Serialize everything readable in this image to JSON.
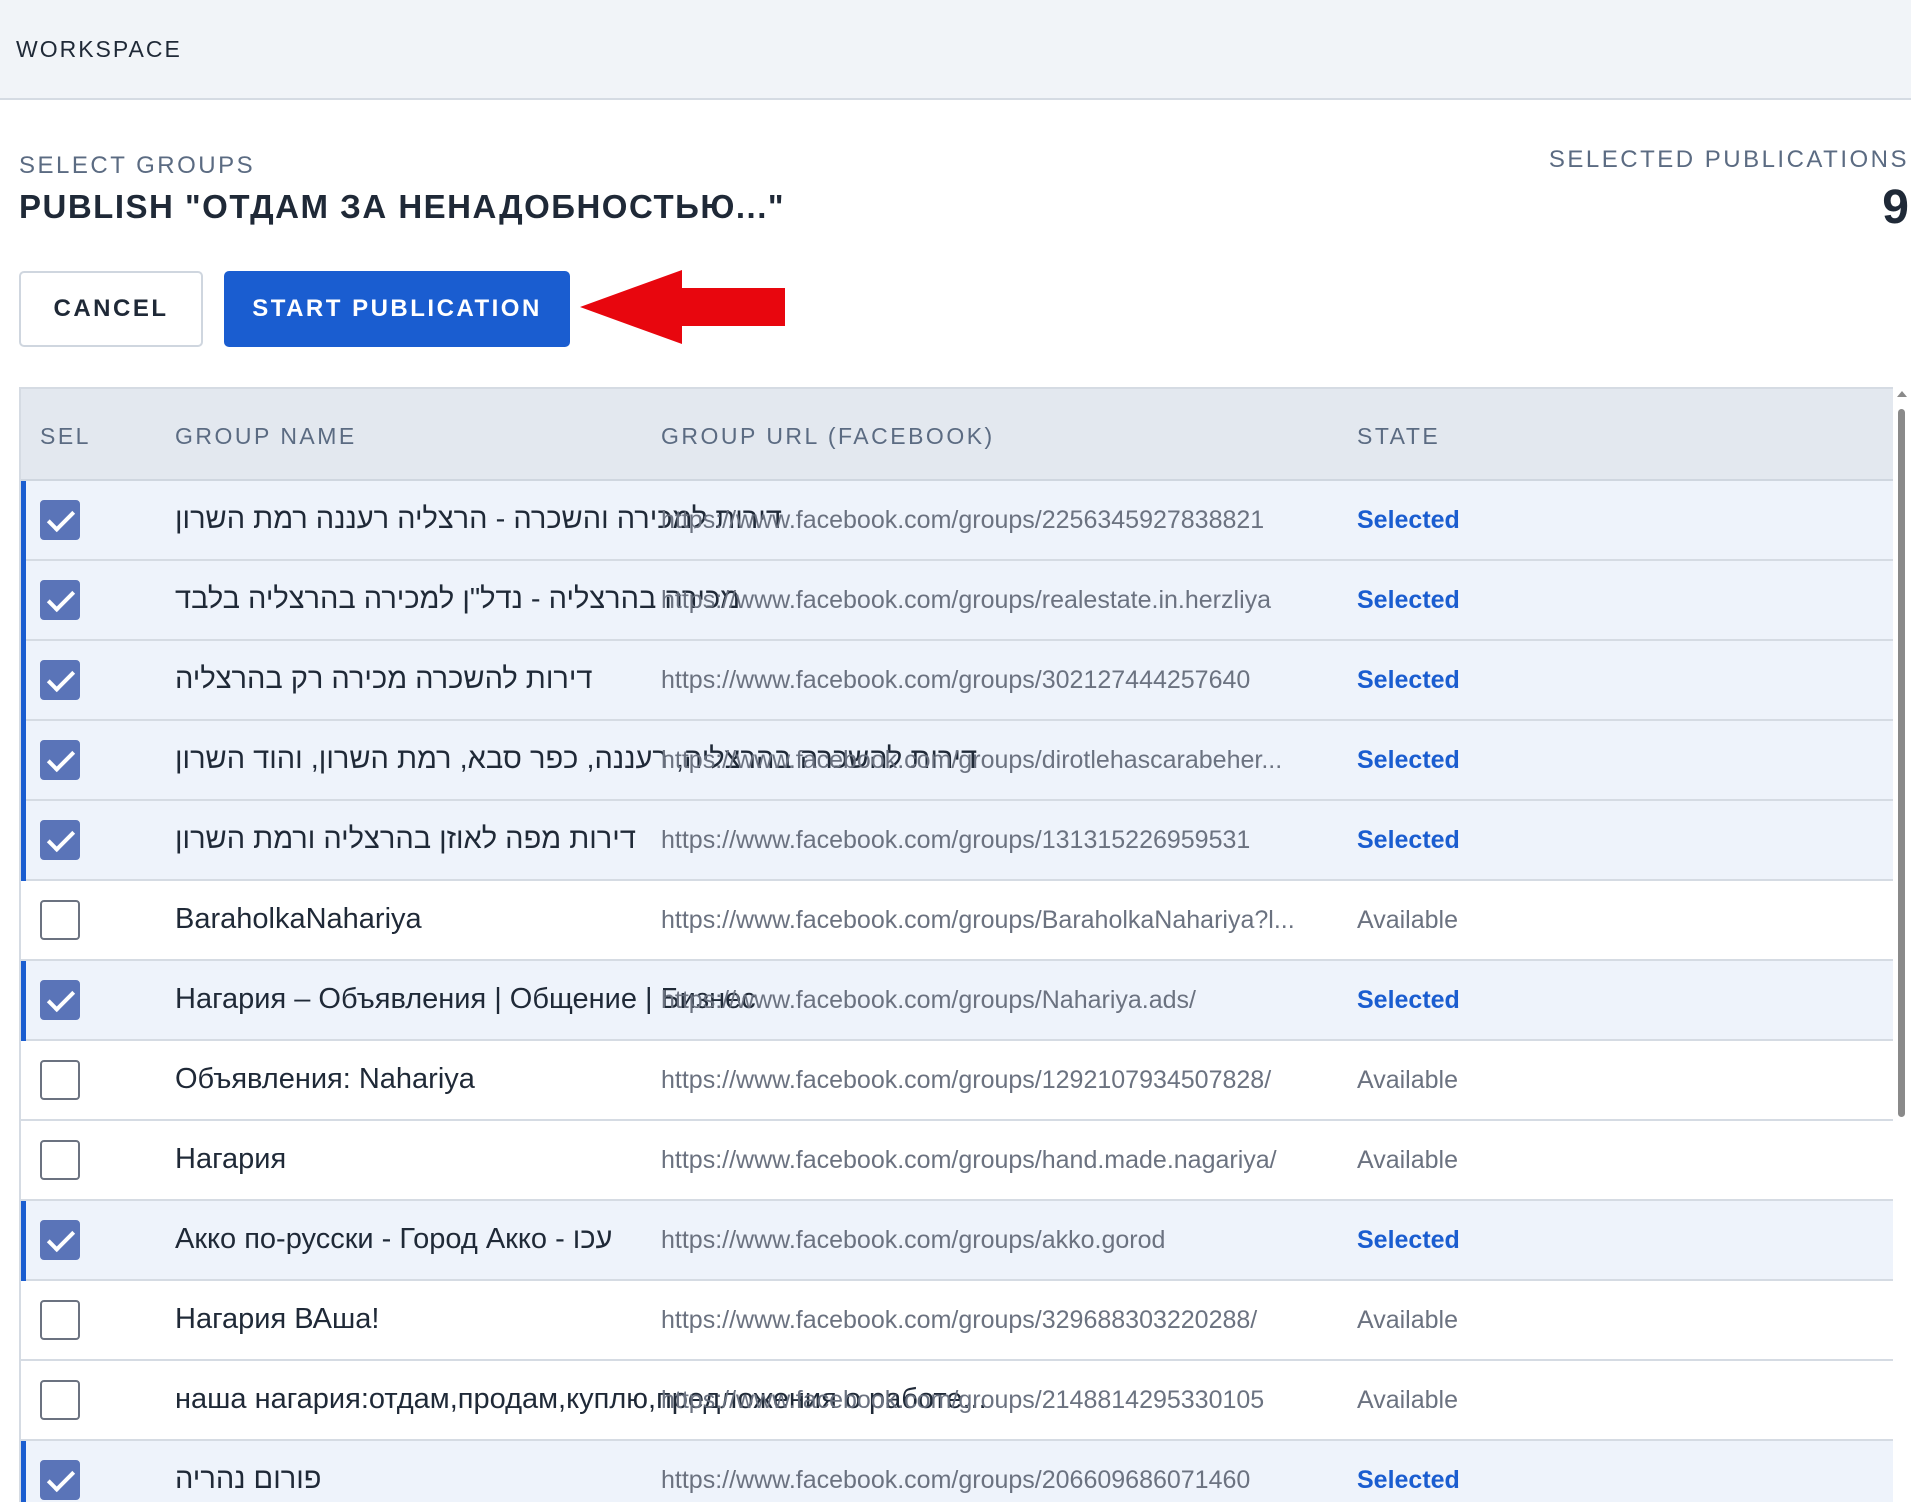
{
  "topbar": {
    "title": "WORKSPACE"
  },
  "header": {
    "sub_label": "SELECT GROUPS",
    "title": "PUBLISH \"ОТДАМ ЗА НЕНАДОБНОСТЬЮ...\"",
    "selected_label": "SELECTED PUBLICATIONS",
    "selected_count": "9"
  },
  "actions": {
    "cancel_label": "CANCEL",
    "start_label": "START PUBLICATION"
  },
  "colors": {
    "accent": "#1a5dd0",
    "arrow": "#e8060e"
  },
  "table": {
    "columns": [
      "SEL",
      "GROUP NAME",
      "GROUP URL (FACEBOOK)",
      "STATE"
    ],
    "rows": [
      {
        "checked": true,
        "name": "דירות למכירה והשכרה - הרצליה רעננה רמת השרון",
        "url": "https://www.facebook.com/groups/2256345927838821",
        "state": "Selected"
      },
      {
        "checked": true,
        "name": "מכירה בהרצליה - נדל\"ן למכירה בהרצליה בלבד",
        "url": "https://www.facebook.com/groups/realestate.in.herzliya",
        "state": "Selected"
      },
      {
        "checked": true,
        "name": "דירות להשכרה מכירה רק בהרצליה",
        "url": "https://www.facebook.com/groups/302127444257640",
        "state": "Selected"
      },
      {
        "checked": true,
        "name": "דירות להשכרה בהרצליה, רעננה, כפר סבא, רמת השרון, והוד השרון",
        "url": "https://www.facebook.com/groups/dirotlehascarabeher...",
        "state": "Selected"
      },
      {
        "checked": true,
        "name": "דירות מפה לאוזן בהרצליה ורמת השרון",
        "url": "https://www.facebook.com/groups/131315226959531",
        "state": "Selected"
      },
      {
        "checked": false,
        "name": "BaraholkaNahariya",
        "url": "https://www.facebook.com/groups/BaraholkaNahariya?l...",
        "state": "Available"
      },
      {
        "checked": true,
        "name": "Нагария – Объявления | Общение | Бизнес",
        "url": "https://www.facebook.com/groups/Nahariya.ads/",
        "state": "Selected"
      },
      {
        "checked": false,
        "name": "Объявления: Nahariya",
        "url": "https://www.facebook.com/groups/1292107934507828/",
        "state": "Available"
      },
      {
        "checked": false,
        "name": "Нагария",
        "url": "https://www.facebook.com/groups/hand.made.nagariya/",
        "state": "Available"
      },
      {
        "checked": true,
        "name": "Акко по-русски - Город Акко - עכו",
        "url": "https://www.facebook.com/groups/akko.gorod",
        "state": "Selected"
      },
      {
        "checked": false,
        "name": "Нагария ВАша!",
        "url": "https://www.facebook.com/groups/329688303220288/",
        "state": "Available"
      },
      {
        "checked": false,
        "name": "наша нагария:отдам,продам,куплю,предложения о работе...",
        "url": "https://www.facebook.com/groups/2148814295330105",
        "state": "Available"
      },
      {
        "checked": true,
        "name": "פורום נהריה",
        "url": "https://www.facebook.com/groups/206609686071460",
        "state": "Selected"
      }
    ]
  }
}
